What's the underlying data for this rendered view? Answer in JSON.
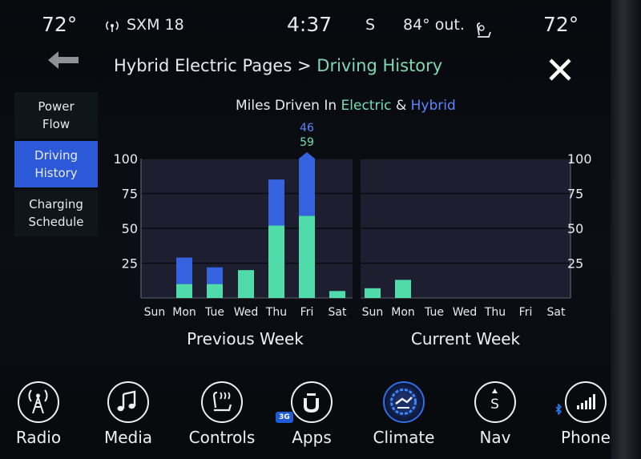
{
  "status": {
    "left_temp": "72°",
    "radio_source": "SXM 18",
    "time": "4:37",
    "compass": "S",
    "outside_temp": "84° out.",
    "right_temp": "72°"
  },
  "header": {
    "breadcrumb_parent": "Hybrid Electric Pages",
    "separator": ">",
    "breadcrumb_current": "Driving History"
  },
  "sidebar": {
    "items": [
      {
        "label": "Power Flow",
        "active": false
      },
      {
        "label": "Driving History",
        "active": true
      },
      {
        "label": "Charging Schedule",
        "active": false
      }
    ]
  },
  "chart": {
    "title_prefix": "Miles Driven In",
    "title_electric": "Electric",
    "title_amp": "&",
    "title_hybrid": "Hybrid"
  },
  "chart_data": {
    "type": "bar",
    "stacked": true,
    "title": "Miles Driven In Electric & Hybrid",
    "ylim": [
      0,
      100
    ],
    "yticks": [
      25,
      50,
      75,
      100
    ],
    "colors": {
      "Electric": "#4fdcaa",
      "Hybrid": "#3562df"
    },
    "groups": [
      {
        "label": "Previous Week",
        "categories": [
          "Sun",
          "Mon",
          "Tue",
          "Wed",
          "Thu",
          "Fri",
          "Sat"
        ],
        "series": [
          {
            "name": "Electric",
            "values": [
              0,
              10,
              10,
              20,
              52,
              59,
              5
            ]
          },
          {
            "name": "Hybrid",
            "values": [
              0,
              19,
              12,
              0,
              33,
              46,
              0
            ]
          }
        ],
        "data_labels": [
          {
            "category": "Fri",
            "hybrid": "46",
            "electric": "59"
          }
        ]
      },
      {
        "label": "Current Week",
        "categories": [
          "Sun",
          "Mon",
          "Tue",
          "Wed",
          "Thu",
          "Fri",
          "Sat"
        ],
        "series": [
          {
            "name": "Electric",
            "values": [
              7,
              13,
              0,
              0,
              0,
              0,
              0
            ]
          },
          {
            "name": "Hybrid",
            "values": [
              0,
              0,
              0,
              0,
              0,
              0,
              0
            ]
          }
        ]
      }
    ]
  },
  "dock": {
    "items": [
      {
        "label": "Radio",
        "icon": "radio-tower-icon"
      },
      {
        "label": "Media",
        "icon": "music-note-icon"
      },
      {
        "label": "Controls",
        "icon": "seat-controls-icon"
      },
      {
        "label": "Apps",
        "icon": "uconnect-apps-icon",
        "badge": "3G"
      },
      {
        "label": "Climate",
        "icon": "climate-fan-icon"
      },
      {
        "label": "Nav",
        "icon": "compass-nav-icon",
        "compass": "S"
      },
      {
        "label": "Phone",
        "icon": "phone-signal-icon"
      }
    ]
  }
}
